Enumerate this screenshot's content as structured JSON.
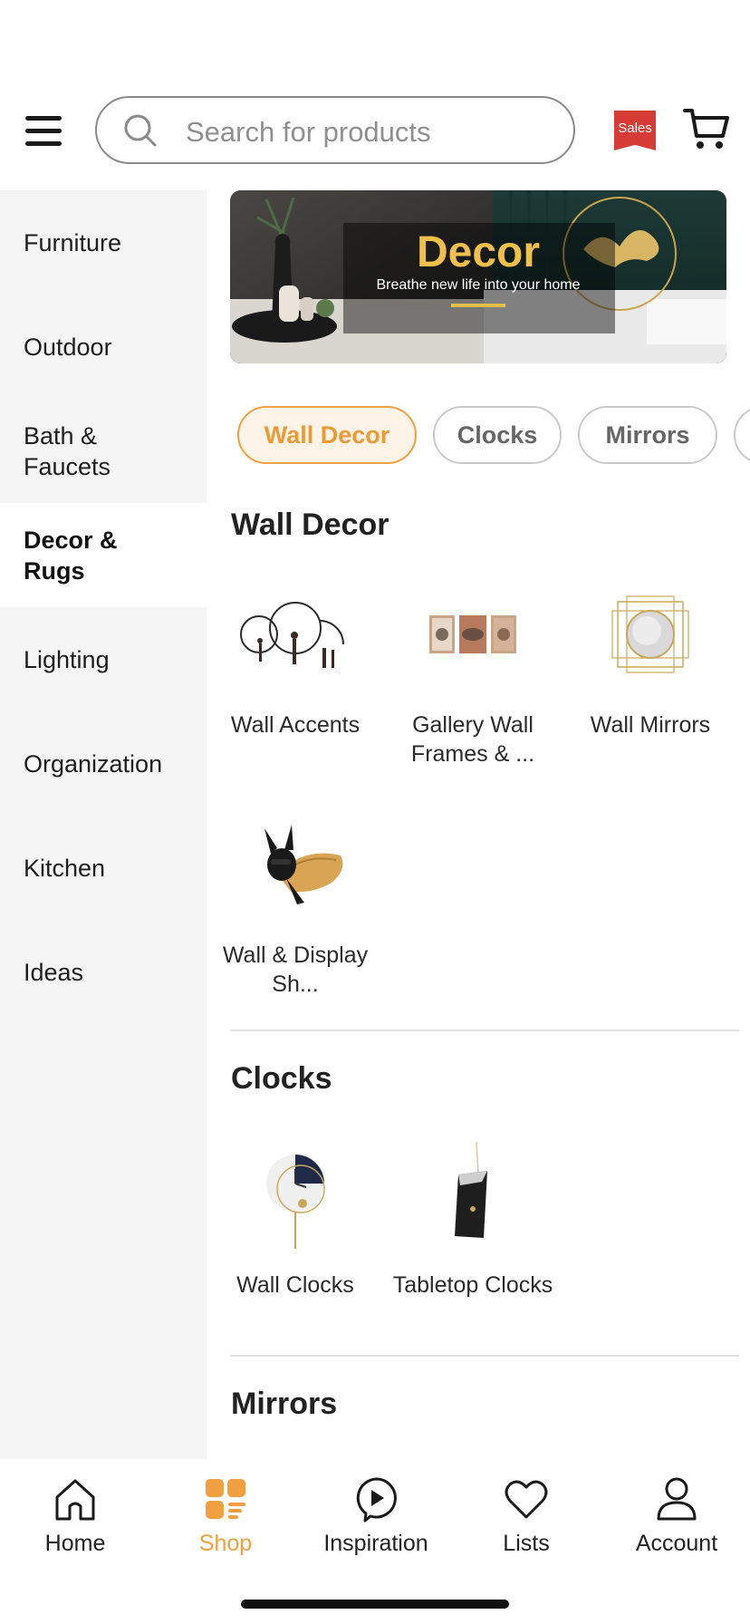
{
  "search": {
    "placeholder": "Search for products"
  },
  "header": {
    "sales_badge": "Sales"
  },
  "sidebar": {
    "items": [
      {
        "label": "Furniture"
      },
      {
        "label": "Outdoor"
      },
      {
        "label": "Bath & Faucets"
      },
      {
        "label": "Decor & Rugs",
        "active": true
      },
      {
        "label": "Lighting"
      },
      {
        "label": "Organization"
      },
      {
        "label": "Kitchen"
      },
      {
        "label": "Ideas"
      }
    ]
  },
  "banner": {
    "title": "Decor",
    "subtitle": "Breathe new life into your home"
  },
  "chips": [
    {
      "label": "Wall Decor",
      "active": true
    },
    {
      "label": "Clocks"
    },
    {
      "label": "Mirrors"
    }
  ],
  "sections": {
    "wall_decor": {
      "title": "Wall Decor",
      "items": [
        {
          "label": "Wall Accents",
          "icon": "wall-accents-image"
        },
        {
          "label": "Gallery Wall Frames & ...",
          "icon": "gallery-frames-image"
        },
        {
          "label": "Wall Mirrors",
          "icon": "wall-mirror-image"
        },
        {
          "label": "Wall & Display Sh...",
          "icon": "wall-shelf-image"
        }
      ]
    },
    "clocks": {
      "title": "Clocks",
      "items": [
        {
          "label": "Wall Clocks",
          "icon": "wall-clock-image"
        },
        {
          "label": "Tabletop Clocks",
          "icon": "tabletop-clock-image"
        }
      ]
    },
    "mirrors": {
      "title": "Mirrors"
    }
  },
  "bottom_nav": {
    "items": [
      {
        "label": "Home",
        "icon": "home-icon"
      },
      {
        "label": "Shop",
        "icon": "shop-icon",
        "active": true
      },
      {
        "label": "Inspiration",
        "icon": "inspiration-icon"
      },
      {
        "label": "Lists",
        "icon": "heart-icon"
      },
      {
        "label": "Account",
        "icon": "account-icon"
      }
    ]
  },
  "colors": {
    "accent": "#f0a040",
    "sales": "#d63c35",
    "sidebar_bg": "#f5f5f5"
  }
}
